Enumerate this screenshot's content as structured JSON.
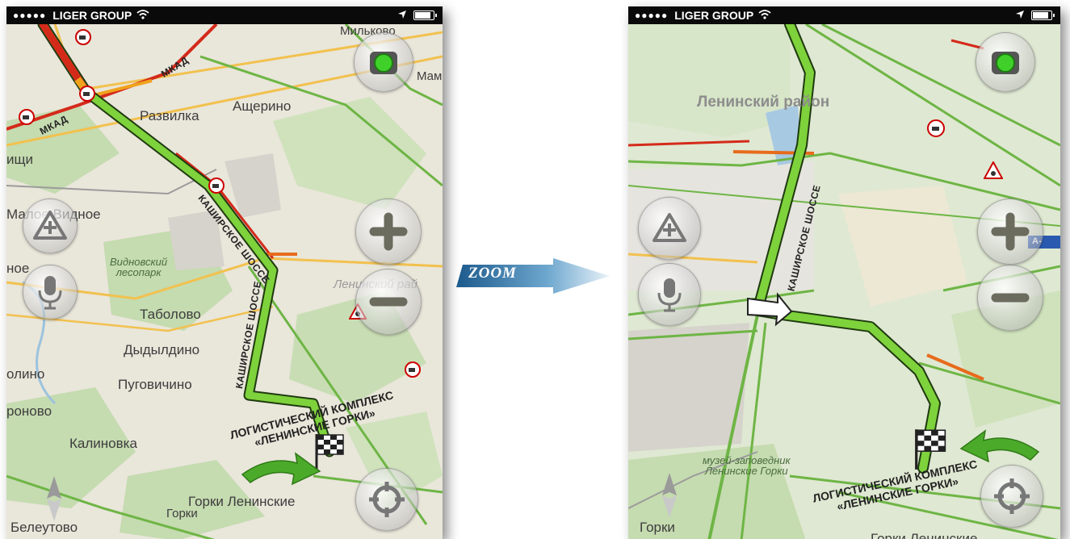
{
  "status_bar": {
    "signal_dots": "●●●●●",
    "carrier": "LIGER GROUP",
    "wifi_icon": "wifi-icon",
    "location_icon": "location-arrow-icon",
    "battery_icon": "battery-icon"
  },
  "zoom_label": "ZOOM",
  "left_map": {
    "places": {
      "milkovo": "Мильково",
      "mam": "Мам",
      "razvilka": "Развилка",
      "ashcherino": "Ащерино",
      "ishchi": "ищи",
      "maloe_vidnoe": "Малое Видное",
      "oe": "ное",
      "vidnovsky_forest_1": "Видновский",
      "vidnovsky_forest_2": "лесопарк",
      "leninsky_rayon": "Ленинский рай",
      "tabolovo": "Таболово",
      "dydyldino": "Дыдылдино",
      "olino": "олино",
      "pugovichino": "Пуговичино",
      "ronovo": "роново",
      "kalinovka": "Калиновка",
      "gorki_leninskie": "Горки Ленинские",
      "gorki": "Горки",
      "beleutovo": "Белеутово"
    },
    "roads": {
      "mkad_1": "МКАД",
      "mkad_2": "МКАД",
      "kashirskoe_1": "КАШИРСКОЕ ШОССЕ",
      "kashirskoe_2": "КАШИРСКОЕ ШОССЕ"
    },
    "destination": {
      "line1": "ЛОГИСТИЧЕСКИЙ КОМПЛЕКС",
      "line2": "«ЛЕНИНСКИЕ ГОРКИ»"
    }
  },
  "right_map": {
    "places": {
      "leninsky_rayon": "Ленинский район",
      "museum_1": "музей-заповедник",
      "museum_2": "Ленинские Горки",
      "gorki": "Горки",
      "gorki_leninskie": "Горки Ленинские"
    },
    "roads": {
      "kashirskoe": "КАШИРСКОЕ ШОССЕ",
      "highway_badge": "A-"
    },
    "destination": {
      "line1": "ЛОГИСТИЧЕСКИЙ КОМПЛЕКС",
      "line2": "«ЛЕНИНСКИЕ ГОРКИ»"
    }
  },
  "controls": {
    "traffic_icon": "traffic-light-icon",
    "report_icon": "road-event-add-icon",
    "zoom_in_icon": "plus-icon",
    "zoom_out_icon": "minus-icon",
    "voice_icon": "microphone-icon",
    "locate_icon": "crosshair-location-icon",
    "compass_icon": "compass-icon"
  },
  "colors": {
    "route_green": "#7ed23b",
    "route_outline": "#1f3a10",
    "traffic_red": "#d42a1a",
    "traffic_orange": "#f0a21c",
    "road_green": "#6eb545",
    "map_bg": "#e9e6da",
    "forest": "#c5dbb0"
  }
}
